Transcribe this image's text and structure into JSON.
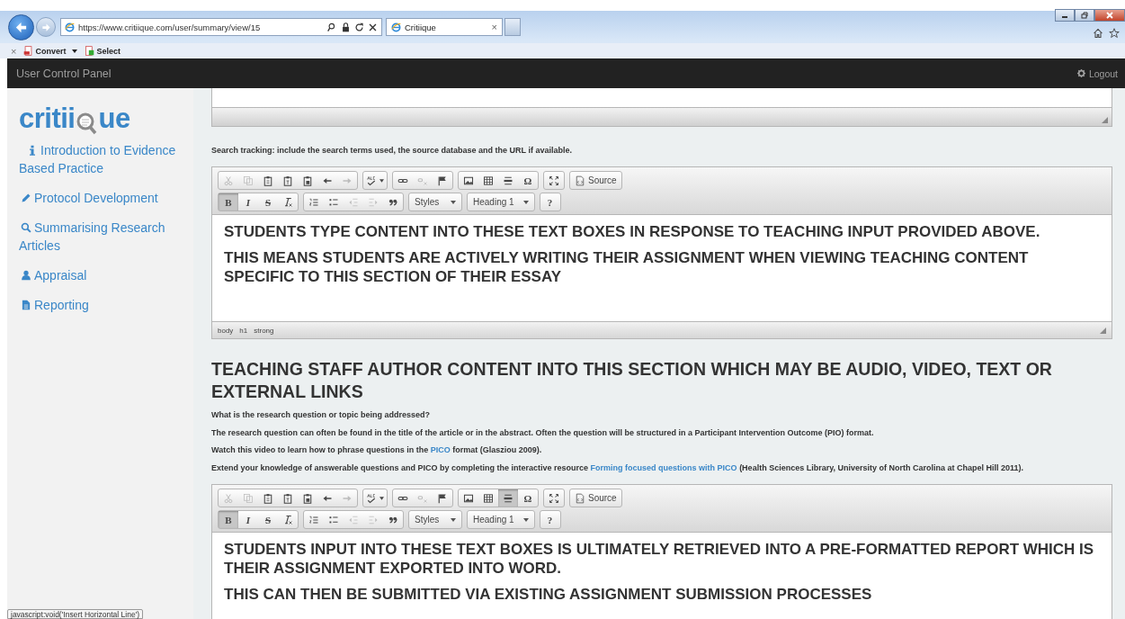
{
  "browser": {
    "url": "https://www.critiique.com/user/summary/view/15",
    "tab": {
      "title": "Critiique",
      "close": "×"
    },
    "toolbar": {
      "close": "×",
      "buttons": [
        {
          "label": "Convert",
          "dropdown": true
        },
        {
          "label": "Select",
          "dropdown": false
        }
      ]
    }
  },
  "header": {
    "title": "User Control Panel",
    "logout": "Logout"
  },
  "sidebar": {
    "logo": {
      "start": "critii",
      "end": "ue"
    },
    "items": [
      {
        "kind": "info",
        "label": "Introduction to Evidence Based Practice"
      },
      {
        "kind": "pencil",
        "label": "Protocol Development"
      },
      {
        "kind": "search",
        "label": "Summarising Research Articles"
      },
      {
        "kind": "user",
        "label": "Appraisal"
      },
      {
        "kind": "file",
        "label": "Reporting"
      }
    ]
  },
  "main": {
    "search_tracking": "Search tracking: include the search terms used, the source database and the URL if available.",
    "editor_1": {
      "toolbar": [
        [
          [
            {
              "kind": "cut",
              "disabled": true,
              "on": false
            },
            {
              "kind": "copy",
              "disabled": true,
              "on": false
            },
            {
              "kind": "paste",
              "disabled": false,
              "on": false
            },
            {
              "kind": "paste-text",
              "disabled": false,
              "on": false
            },
            {
              "kind": "paste-word",
              "disabled": false,
              "on": false
            },
            {
              "kind": "undo",
              "disabled": false,
              "on": false
            },
            {
              "kind": "redo",
              "disabled": true,
              "on": false
            }
          ],
          [
            {
              "kind": "spellcheck",
              "disabled": false,
              "on": false
            }
          ],
          [
            {
              "kind": "link",
              "disabled": false,
              "on": false
            },
            {
              "kind": "unlink",
              "disabled": true,
              "on": false
            },
            {
              "kind": "anchor",
              "disabled": false,
              "on": false
            }
          ],
          [
            {
              "kind": "image",
              "disabled": false,
              "on": false
            },
            {
              "kind": "table",
              "disabled": false,
              "on": false
            },
            {
              "kind": "hr",
              "disabled": false,
              "on": false
            },
            {
              "kind": "text",
              "label": "Ω",
              "disabled": false,
              "on": false
            }
          ],
          [
            {
              "kind": "maximize",
              "disabled": false,
              "on": false
            }
          ],
          [
            {
              "kind": "source",
              "label": "Source",
              "disabled": false,
              "on": false
            }
          ]
        ],
        [
          [
            {
              "kind": "text",
              "label": "B",
              "disabled": false,
              "on": true
            },
            {
              "kind": "italic",
              "label": "I",
              "disabled": false,
              "on": false
            },
            {
              "kind": "strike",
              "label": "S",
              "disabled": false,
              "on": false
            },
            {
              "kind": "remove-format",
              "disabled": false,
              "on": false
            }
          ],
          [
            {
              "kind": "numbered-list",
              "disabled": false,
              "on": false
            },
            {
              "kind": "bulleted-list",
              "disabled": false,
              "on": false
            },
            {
              "kind": "outdent",
              "disabled": true,
              "on": false
            },
            {
              "kind": "indent",
              "disabled": true,
              "on": false
            },
            {
              "kind": "blockquote",
              "disabled": false,
              "on": false
            }
          ],
          [
            {
              "kind": "combo",
              "label": "Styles",
              "disabled": false,
              "on": false
            }
          ],
          [
            {
              "kind": "combo",
              "label": "Heading 1",
              "disabled": false,
              "on": false
            }
          ],
          [
            {
              "kind": "text",
              "label": "?",
              "disabled": false,
              "on": false
            }
          ]
        ]
      ],
      "content": [
        "STUDENTS TYPE CONTENT INTO THESE TEXT BOXES IN RESPONSE TO TEACHING INPUT PROVIDED ABOVE.",
        "THIS MEANS STUDENTS ARE ACTIVELY WRITING THEIR ASSIGNMENT WHEN VIEWING TEACHING CONTENT SPECIFIC TO THIS SECTION OF THEIR ESSAY"
      ],
      "path": [
        "body",
        "h1",
        "strong"
      ]
    },
    "section": {
      "heading": "TEACHING STAFF AUTHOR CONTENT INTO THIS SECTION WHICH MAY BE AUDIO, VIDEO, TEXT OR EXTERNAL LINKS",
      "paragraphs": [
        [
          {
            "kind": "text",
            "text": "What is the research question or topic being addressed?"
          }
        ],
        [
          {
            "kind": "text",
            "text": "The research question can often be found in the title of the article or in the abstract. Often the question will be structured in a Participant Intervention Outcome (PIO) format."
          }
        ],
        [
          {
            "kind": "text",
            "text": "Watch this video to learn how to phrase questions in the "
          },
          {
            "kind": "link",
            "text": "PICO"
          },
          {
            "kind": "text",
            "text": " format (Glasziou 2009)."
          }
        ],
        [
          {
            "kind": "text",
            "text": "Extend your knowledge of answerable questions and PICO by completing the interactive resource "
          },
          {
            "kind": "link",
            "text": "Forming focused questions with PICO"
          },
          {
            "kind": "text",
            "text": " (Health Sciences Library, University of North Carolina at Chapel Hill 2011)."
          }
        ]
      ]
    },
    "editor_2": {
      "toolbar": [
        [
          [
            {
              "kind": "cut",
              "disabled": true,
              "on": false
            },
            {
              "kind": "copy",
              "disabled": true,
              "on": false
            },
            {
              "kind": "paste",
              "disabled": false,
              "on": false
            },
            {
              "kind": "paste-text",
              "disabled": false,
              "on": false
            },
            {
              "kind": "paste-word",
              "disabled": false,
              "on": false
            },
            {
              "kind": "undo",
              "disabled": false,
              "on": false
            },
            {
              "kind": "redo",
              "disabled": true,
              "on": false
            }
          ],
          [
            {
              "kind": "spellcheck",
              "disabled": false,
              "on": false
            }
          ],
          [
            {
              "kind": "link",
              "disabled": false,
              "on": false
            },
            {
              "kind": "unlink",
              "disabled": true,
              "on": false
            },
            {
              "kind": "anchor",
              "disabled": false,
              "on": false
            }
          ],
          [
            {
              "kind": "image",
              "disabled": false,
              "on": false
            },
            {
              "kind": "table",
              "disabled": false,
              "on": false
            },
            {
              "kind": "hr",
              "disabled": false,
              "on": true
            },
            {
              "kind": "text",
              "label": "Ω",
              "disabled": false,
              "on": false
            }
          ],
          [
            {
              "kind": "maximize",
              "disabled": false,
              "on": false
            }
          ],
          [
            {
              "kind": "source",
              "label": "Source",
              "disabled": false,
              "on": false
            }
          ]
        ],
        [
          [
            {
              "kind": "text",
              "label": "B",
              "disabled": false,
              "on": true
            },
            {
              "kind": "italic",
              "label": "I",
              "disabled": false,
              "on": false
            },
            {
              "kind": "strike",
              "label": "S",
              "disabled": false,
              "on": false
            },
            {
              "kind": "remove-format",
              "disabled": false,
              "on": false
            }
          ],
          [
            {
              "kind": "numbered-list",
              "disabled": false,
              "on": false
            },
            {
              "kind": "bulleted-list",
              "disabled": false,
              "on": false
            },
            {
              "kind": "outdent",
              "disabled": true,
              "on": false
            },
            {
              "kind": "indent",
              "disabled": true,
              "on": false
            },
            {
              "kind": "blockquote",
              "disabled": false,
              "on": false
            }
          ],
          [
            {
              "kind": "combo",
              "label": "Styles",
              "disabled": false,
              "on": false
            }
          ],
          [
            {
              "kind": "combo",
              "label": "Heading 1",
              "disabled": false,
              "on": false
            }
          ],
          [
            {
              "kind": "text",
              "label": "?",
              "disabled": false,
              "on": false
            }
          ]
        ]
      ],
      "content": [
        "STUDENTS INPUT INTO THESE TEXT BOXES IS ULTIMATELY RETRIEVED INTO A PRE-FORMATTED REPORT WHICH IS THEIR ASSIGNMENT EXPORTED INTO WORD.",
        "THIS CAN THEN BE SUBMITTED VIA EXISTING ASSIGNMENT SUBMISSION PROCESSES"
      ]
    }
  },
  "status_tooltip": "javascript:void('Insert Horizontal Line')"
}
